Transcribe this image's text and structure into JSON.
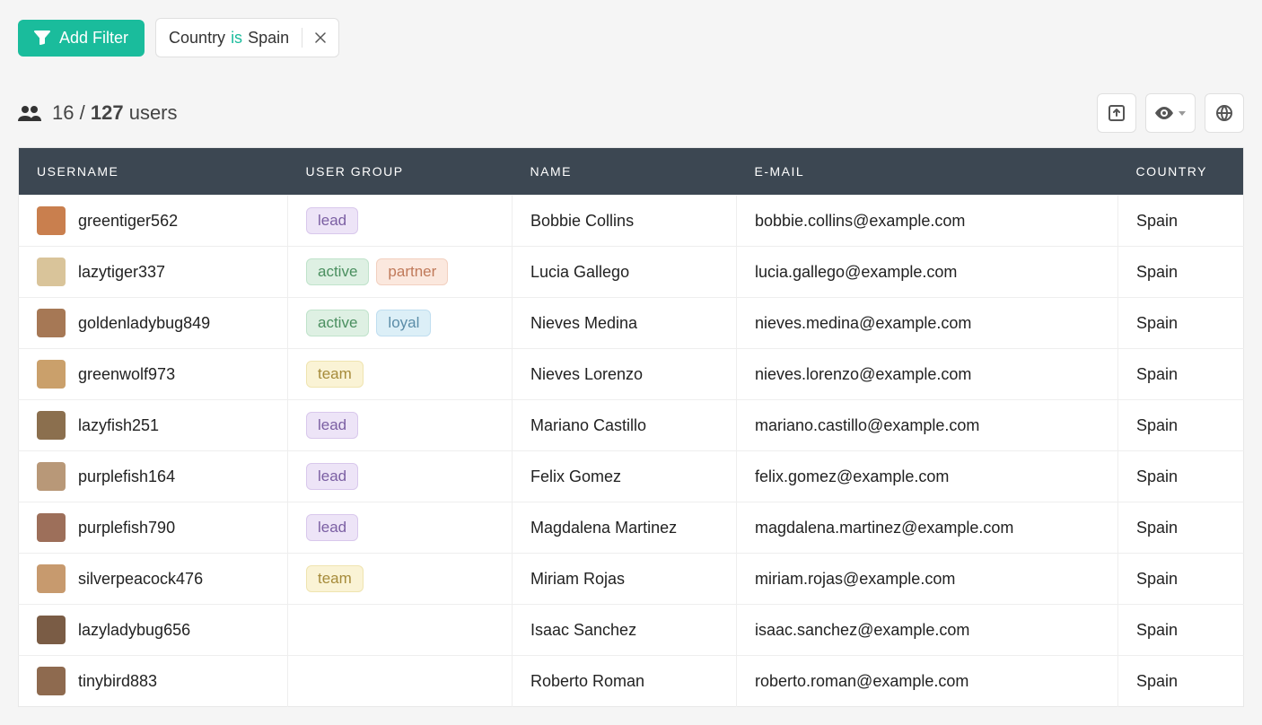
{
  "filter_bar": {
    "add_filter_label": "Add Filter",
    "chip": {
      "field": "Country",
      "operator": "is",
      "value": "Spain"
    }
  },
  "summary": {
    "filtered": "16",
    "separator": "/",
    "total": "127",
    "unit": "users"
  },
  "columns": {
    "username": "USERNAME",
    "group": "USER GROUP",
    "name": "NAME",
    "email": "E-MAIL",
    "country": "COUNTRY"
  },
  "badge_styles": {
    "lead": "badge-lead",
    "active": "badge-active",
    "partner": "badge-partner",
    "loyal": "badge-loyal",
    "team": "badge-team"
  },
  "avatar_colors": [
    "#c97f4e",
    "#d9c49a",
    "#a67855",
    "#caa06b",
    "#8b6f4e",
    "#b89878",
    "#9d6f5a",
    "#c79a6e",
    "#7a5c45",
    "#8e6a4f"
  ],
  "rows": [
    {
      "username": "greentiger562",
      "groups": [
        "lead"
      ],
      "name": "Bobbie Collins",
      "email": "bobbie.collins@example.com",
      "country": "Spain"
    },
    {
      "username": "lazytiger337",
      "groups": [
        "active",
        "partner"
      ],
      "name": "Lucia Gallego",
      "email": "lucia.gallego@example.com",
      "country": "Spain"
    },
    {
      "username": "goldenladybug849",
      "groups": [
        "active",
        "loyal"
      ],
      "name": "Nieves Medina",
      "email": "nieves.medina@example.com",
      "country": "Spain"
    },
    {
      "username": "greenwolf973",
      "groups": [
        "team"
      ],
      "name": "Nieves Lorenzo",
      "email": "nieves.lorenzo@example.com",
      "country": "Spain"
    },
    {
      "username": "lazyfish251",
      "groups": [
        "lead"
      ],
      "name": "Mariano Castillo",
      "email": "mariano.castillo@example.com",
      "country": "Spain"
    },
    {
      "username": "purplefish164",
      "groups": [
        "lead"
      ],
      "name": "Felix Gomez",
      "email": "felix.gomez@example.com",
      "country": "Spain"
    },
    {
      "username": "purplefish790",
      "groups": [
        "lead"
      ],
      "name": "Magdalena Martinez",
      "email": "magdalena.martinez@example.com",
      "country": "Spain"
    },
    {
      "username": "silverpeacock476",
      "groups": [
        "team"
      ],
      "name": "Miriam Rojas",
      "email": "miriam.rojas@example.com",
      "country": "Spain"
    },
    {
      "username": "lazyladybug656",
      "groups": [],
      "name": "Isaac Sanchez",
      "email": "isaac.sanchez@example.com",
      "country": "Spain"
    },
    {
      "username": "tinybird883",
      "groups": [],
      "name": "Roberto Roman",
      "email": "roberto.roman@example.com",
      "country": "Spain"
    }
  ]
}
